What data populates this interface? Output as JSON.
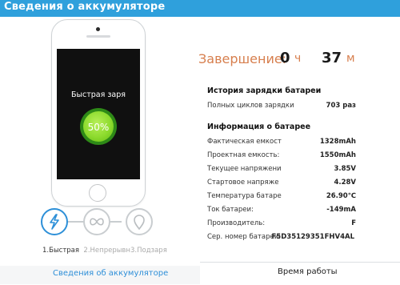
{
  "window": {
    "title": "Сведения о аккумуляторе"
  },
  "phone": {
    "screen_label": "Быстрая заря",
    "percent": "50%",
    "level_fraction": 0.5
  },
  "modes": {
    "items": [
      {
        "icon": "lightning-icon",
        "state": "active"
      },
      {
        "icon": "infinity-icon",
        "state": "inactive"
      },
      {
        "icon": "location-pin-icon",
        "state": "inactive"
      }
    ],
    "label_1": "1.Быстрая",
    "label_2": "2.Непрерывн",
    "label_3": "3.Подзаря"
  },
  "details_tab": {
    "label": "Сведения об аккумуляторе"
  },
  "uptime_tab": {
    "label": "Время работы"
  },
  "completion": {
    "label": "Завершение:",
    "hours": "0",
    "hours_unit": "ч",
    "minutes": "37",
    "minutes_unit": "м"
  },
  "history": {
    "title": "История зарядки батареи",
    "rows": [
      {
        "key": "Полных циклов зарядки",
        "value": "703 раз"
      }
    ]
  },
  "battery_info": {
    "title": "Информация о батарее",
    "rows": [
      {
        "key": "Фактическая емкост",
        "value": "1328mAh"
      },
      {
        "key": "Проектная емкость:",
        "value": "1550mAh"
      },
      {
        "key": "Текущее напряжени",
        "value": "3.85V"
      },
      {
        "key": "Стартовое напряже",
        "value": "4.28V"
      },
      {
        "key": "Температура батаре",
        "value": "26.90℃"
      },
      {
        "key": "Ток батареи:",
        "value": "-149mA"
      },
      {
        "key": "Производитель:",
        "value": "F"
      },
      {
        "key": "Сер. номер батареи:",
        "value": "F5D35129351FHV4AL"
      }
    ]
  },
  "colors": {
    "title_bar": "#2fa0dc",
    "accent_blue": "#2e8fd8",
    "completion_label": "#d77f4e",
    "battery_green": "#8ddb2e"
  }
}
